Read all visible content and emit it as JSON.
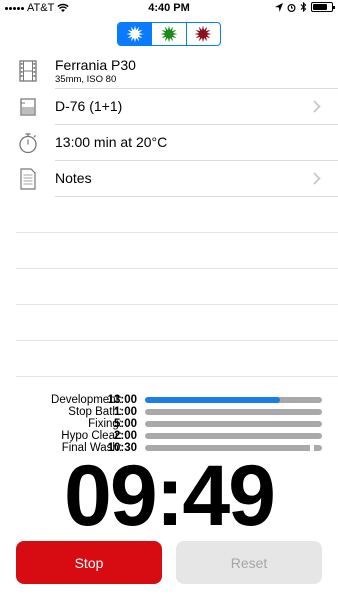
{
  "status_bar": {
    "carrier": "AT&T",
    "time": "4:40 PM"
  },
  "mode_selector": {
    "options": [
      {
        "icon": "white-star-icon",
        "color": "#ffffff",
        "selected": true
      },
      {
        "icon": "green-star-icon",
        "color": "#1a8a1a",
        "selected": false
      },
      {
        "icon": "red-star-icon",
        "color": "#8a1020",
        "selected": false
      }
    ],
    "accent": "#0a7aff"
  },
  "film": {
    "name": "Ferrania P30",
    "details": "35mm, ISO 80"
  },
  "developer": {
    "label": "D-76 (1+1)"
  },
  "dev_time": {
    "label": "13:00 min at 20°C"
  },
  "notes": {
    "label": "Notes"
  },
  "steps": [
    {
      "name": "Development:",
      "duration": "13:00",
      "progress": 0.76
    },
    {
      "name": "Stop Bath:",
      "duration": "1:00",
      "progress": 0
    },
    {
      "name": "Fixing:",
      "duration": "5:00",
      "progress": 0
    },
    {
      "name": "Hypo Clear:",
      "duration": "2:00",
      "progress": 0
    },
    {
      "name": "Final Wash:",
      "duration": "10:30",
      "progress": 0
    }
  ],
  "colors": {
    "progress_done": "#1a7ee8",
    "progress_remaining": "#a9a9a9",
    "stop": "#d60c12"
  },
  "timer": "09:49",
  "buttons": {
    "stop": "Stop",
    "reset": "Reset"
  }
}
